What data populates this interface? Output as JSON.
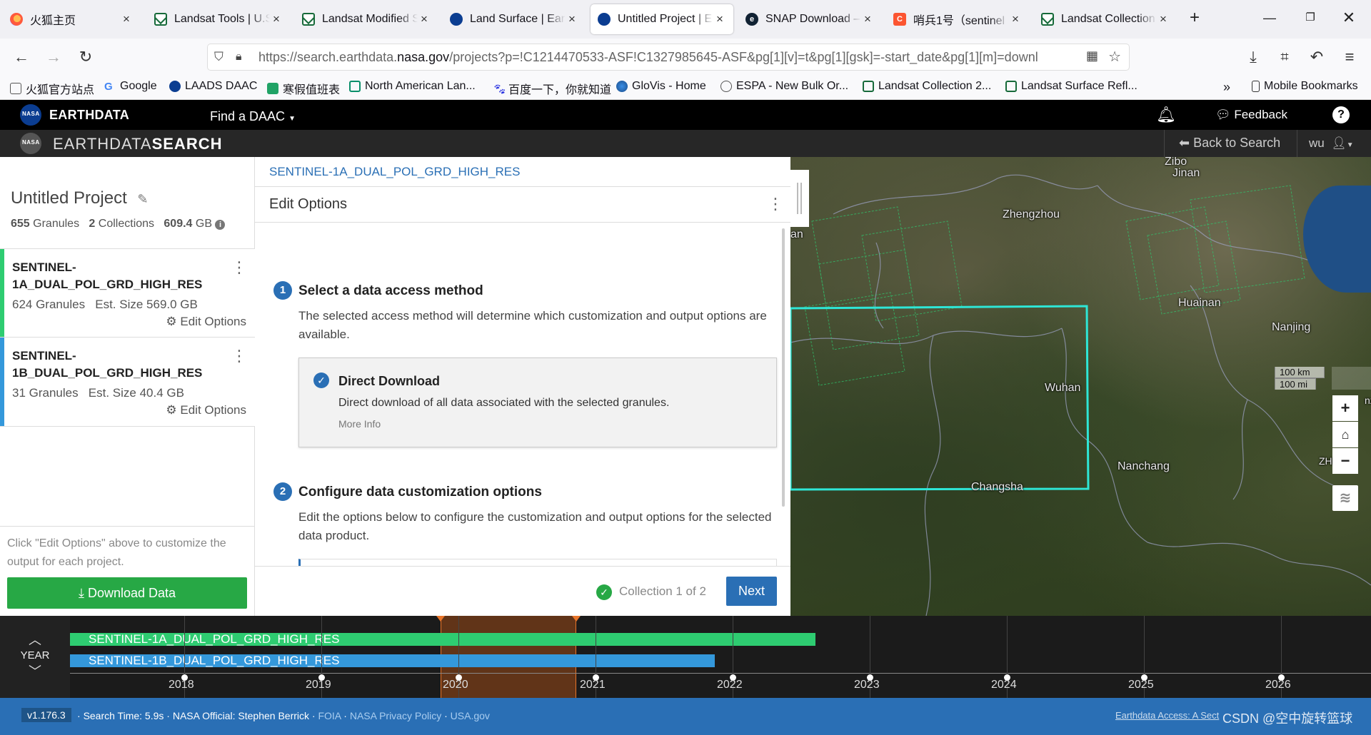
{
  "browser": {
    "tabs": [
      {
        "label": "火狐主页",
        "icon": "firefox-icon"
      },
      {
        "label": "Landsat Tools | U.S",
        "icon": "usgs-icon"
      },
      {
        "label": "Landsat Modified S",
        "icon": "usgs-icon"
      },
      {
        "label": "Land Surface | Eart",
        "icon": "nasa-icon"
      },
      {
        "label": "Untitled Project | E",
        "icon": "nasa-icon"
      },
      {
        "label": "SNAP Download –",
        "icon": "snap-icon"
      },
      {
        "label": "哨兵1号（sentinel",
        "icon": "csdn-icon"
      },
      {
        "label": "Landsat Collection",
        "icon": "usgs-icon"
      }
    ],
    "url_prefix": "https://search.earthdata.",
    "url_domain": "nasa.gov",
    "url_rest": "/projects?p=!C1214470533-ASF!C1327985645-ASF&pg[1][v]=t&pg[1][gsk]=-start_date&pg[1][m]=downl",
    "bookmarks": [
      "火狐官方站点",
      "Google",
      "LAADS DAAC",
      "寒假值班表",
      "North American Lan...",
      "百度一下，你就知道",
      "GloVis - Home",
      "ESPA - New Bulk Or...",
      "Landsat Collection 2...",
      "Landsat Surface Refl..."
    ],
    "mobile_bookmarks": "Mobile Bookmarks"
  },
  "earthdata": {
    "brand": "EARTHDATA",
    "find_daac": "Find a DAAC",
    "feedback": "Feedback",
    "search_brand_a": "EARTHDATA",
    "search_brand_b": "SEARCH",
    "back_to_search": "Back to Search",
    "user": "wu"
  },
  "project": {
    "title": "Untitled Project",
    "granules_count": "655",
    "granules_label": "Granules",
    "collections_count": "2",
    "collections_label": "Collections",
    "size_value": "609.4",
    "size_unit": "GB",
    "collections": [
      {
        "name_line1": "SENTINEL-",
        "name_line2": "1A_DUAL_POL_GRD_HIGH_RES",
        "meta": "624 Granules   Est. Size 569.0 GB",
        "edit": "Edit Options",
        "color": "#2ecc71"
      },
      {
        "name_line1": "SENTINEL-",
        "name_line2": "1B_DUAL_POL_GRD_HIGH_RES",
        "meta": "31 Granules   Est. Size 40.4 GB",
        "edit": "Edit Options",
        "color": "#3498db"
      }
    ],
    "hint": "Click \"Edit Options\" above to customize the output for each project.",
    "download_button": "Download Data"
  },
  "panel": {
    "breadcrumb": "SENTINEL-1A_DUAL_POL_GRD_HIGH_RES",
    "heading": "Edit Options",
    "step1_num": "1",
    "step1_title": "Select a data access method",
    "step1_desc": "The selected access method will determine which customization and output options are available.",
    "method_title": "Direct Download",
    "method_desc": "Direct download of all data associated with the selected granules.",
    "method_more": "More Info",
    "step2_num": "2",
    "step2_title": "Configure data customization options",
    "step2_desc": "Edit the options below to configure the customization and output options for the selected data product.",
    "collection_status": "Collection 1 of 2",
    "next_button": "Next"
  },
  "map": {
    "cities": [
      "Jinan",
      "Zhengzhou",
      "Huainan",
      "Nanjing",
      "Wuhan",
      "Nanchang",
      "Changsha",
      "Zibo",
      "an",
      "ZHEJIA",
      "nz"
    ],
    "scale_km": "100 km",
    "scale_mi": "100 mi"
  },
  "timeline": {
    "zoom_label": "YEAR",
    "years": [
      "2018",
      "2019",
      "2020",
      "2021",
      "2022",
      "2023",
      "2024",
      "2025",
      "2026"
    ],
    "rows": [
      {
        "label": "SENTINEL-1A_DUAL_POL_GRD_HIGH_RES",
        "color": "#2ecc71"
      },
      {
        "label": "SENTINEL-1B_DUAL_POL_GRD_HIGH_RES",
        "color": "#3498db"
      }
    ]
  },
  "footer": {
    "version": "v1.176.3",
    "search_time": "Search Time: 5.9s",
    "official": "NASA Official: Stephen Berrick",
    "foia": "FOIA",
    "privacy": "NASA Privacy Policy",
    "usa": "USA.gov",
    "access_link": "Earthdata Access: A Sect",
    "watermark": "CSDN @空中旋转篮球"
  }
}
